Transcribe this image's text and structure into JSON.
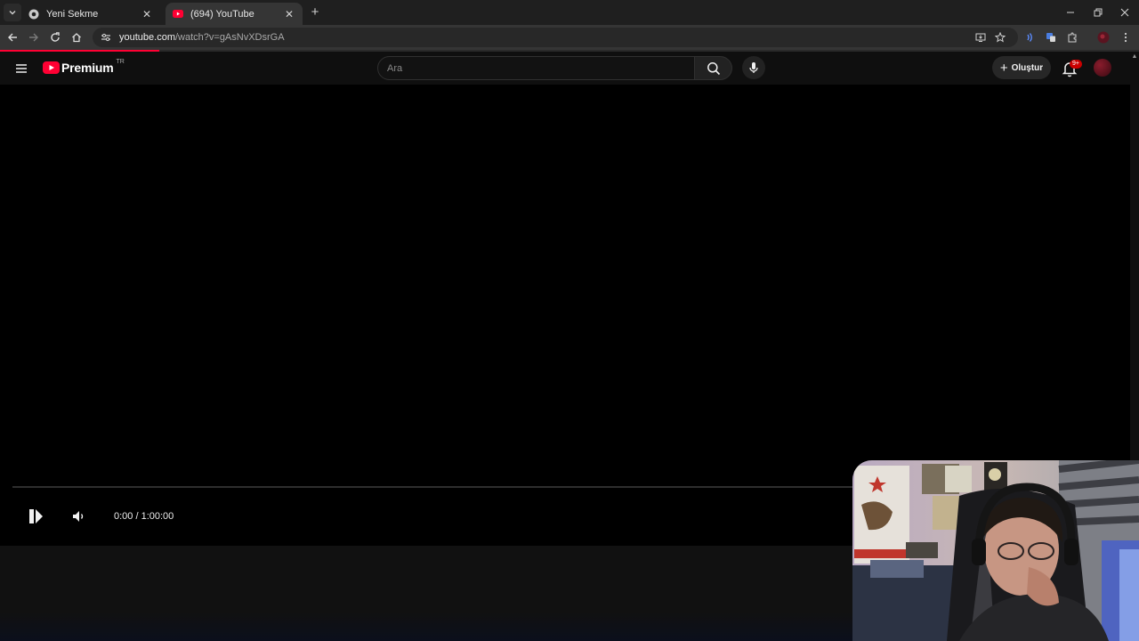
{
  "browser": {
    "tabs": [
      {
        "title": "Yeni Sekme",
        "active": false,
        "icon": "chrome-icon"
      },
      {
        "title": "(694) YouTube",
        "active": true,
        "icon": "youtube-favicon-icon"
      }
    ],
    "url_host": "youtube.com",
    "url_path": "/watch?v=gAsNvXDsrGA",
    "page_load_progress": 0.14
  },
  "masthead": {
    "logo_text": "Premium",
    "country_code": "TR",
    "search_placeholder": "Ara",
    "create_label": "Oluştur",
    "notification_count": "9+"
  },
  "player": {
    "time_display": "0:00 / 1:00:00",
    "progress": 0,
    "state": "paused"
  },
  "colors": {
    "brand_red": "#ff0033",
    "background": "#0f0f0f",
    "player_bg": "#000000"
  }
}
